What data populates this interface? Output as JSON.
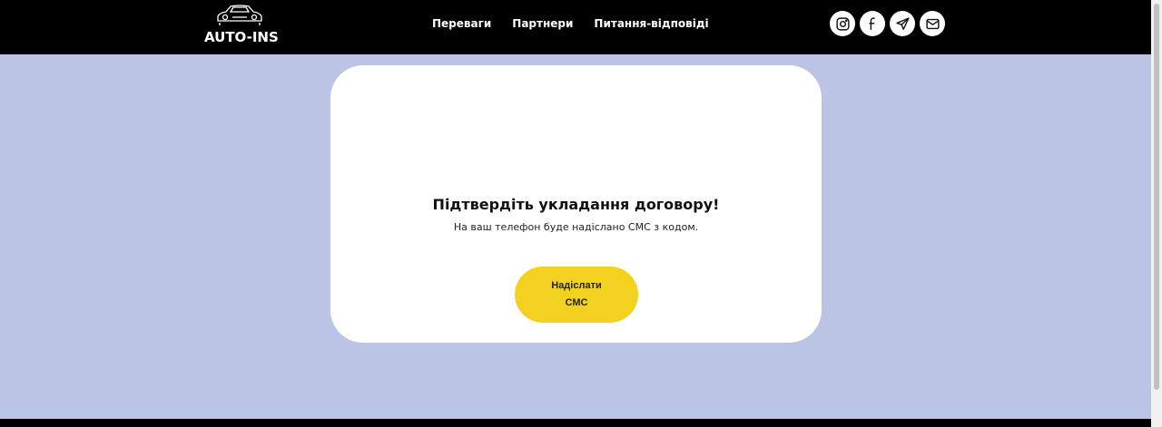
{
  "header": {
    "logo_text": "AUTO-INS",
    "logo_icon": "car-icon",
    "nav": [
      {
        "label": "Переваги"
      },
      {
        "label": "Партнери"
      },
      {
        "label": "Питання-відповіді"
      }
    ],
    "socials": [
      {
        "icon": "instagram-icon"
      },
      {
        "icon": "facebook-icon"
      },
      {
        "icon": "telegram-icon"
      },
      {
        "icon": "mail-icon"
      }
    ]
  },
  "card": {
    "title": "Підтвердіть укладання договору!",
    "subtitle": "На ваш телефон буде надіслано СМС з кодом.",
    "button_label": "Надіслати СМС"
  },
  "colors": {
    "header_bg": "#000000",
    "page_bg": "#bcc4e6",
    "card_bg": "#ffffff",
    "accent": "#f2d21e"
  }
}
